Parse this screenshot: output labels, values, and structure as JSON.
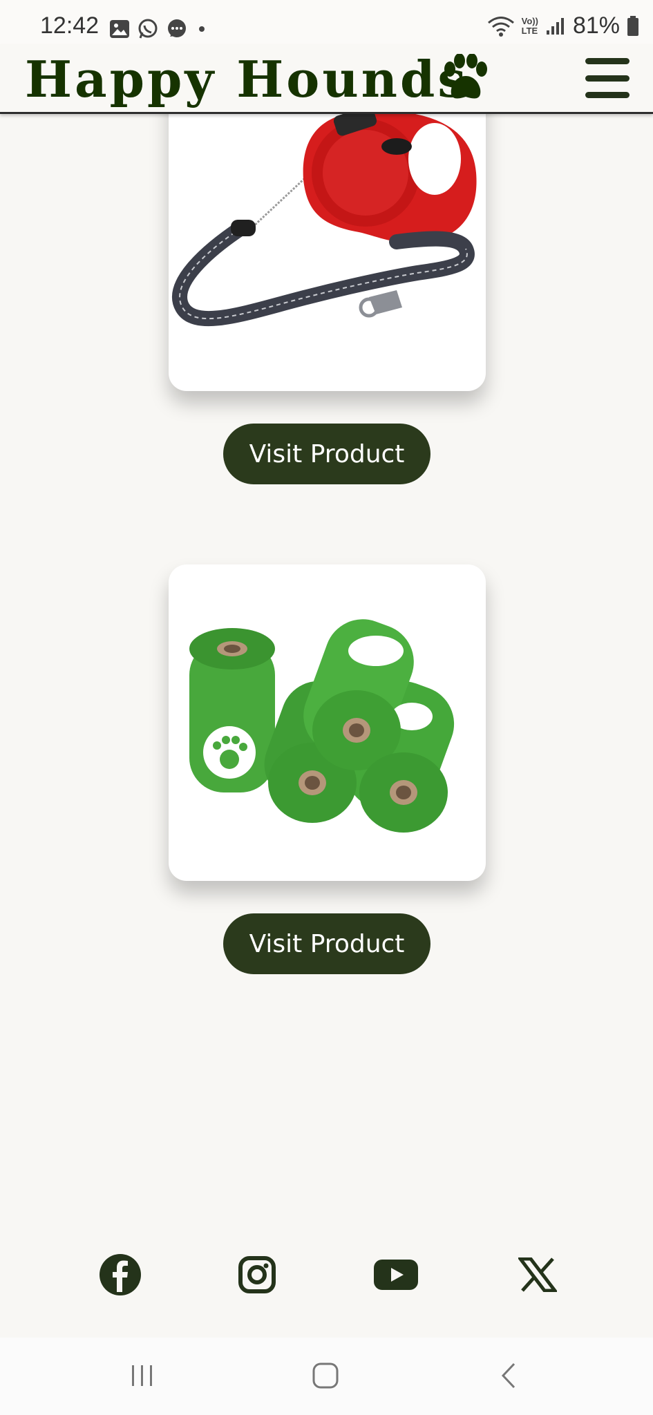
{
  "status": {
    "time": "12:42",
    "battery": "81%",
    "icons": [
      "gallery-icon",
      "whatsapp-icon",
      "message-icon",
      "dot-icon",
      "wifi-icon",
      "volte-icon",
      "signal-icon",
      "battery-icon"
    ],
    "volte_label_top": "Vo))",
    "volte_label_bottom": "LTE"
  },
  "header": {
    "brand": "Happy Hounds",
    "logo_icon": "paw-icon",
    "menu_icon": "hamburger-menu-icon",
    "colors": {
      "brand": "#163300",
      "button": "#2b3a1c"
    }
  },
  "products": [
    {
      "image": "retractable-dog-leash-red",
      "button_label": "Visit Product"
    },
    {
      "image": "green-dog-poop-bag-rolls",
      "button_label": "Visit Product"
    }
  ],
  "footer": {
    "social": [
      "facebook-icon",
      "instagram-icon",
      "youtube-icon",
      "x-icon"
    ]
  },
  "nav": {
    "items": [
      "recent-apps-icon",
      "home-icon",
      "back-icon"
    ]
  }
}
